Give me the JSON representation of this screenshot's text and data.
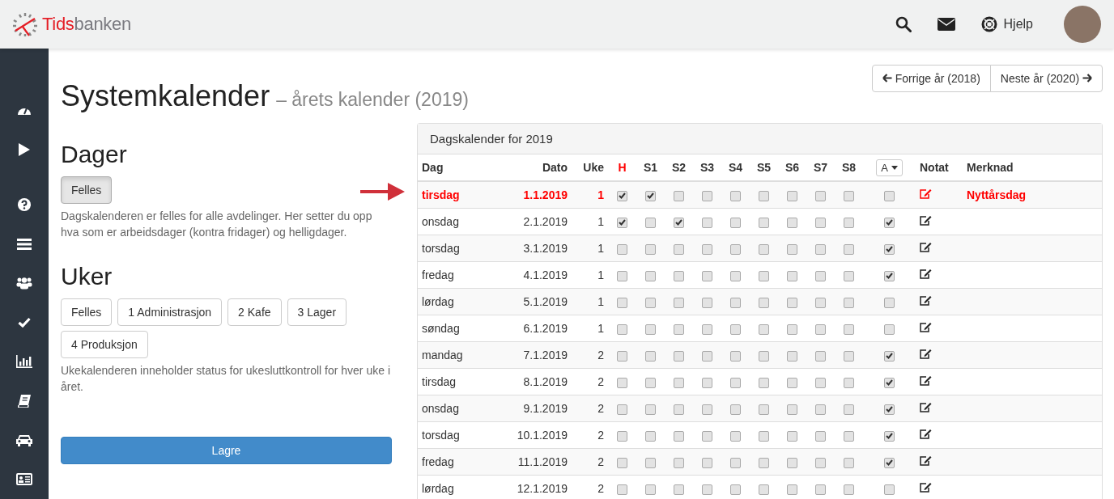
{
  "brand": {
    "part_a": "Tids",
    "part_b": "banken"
  },
  "topbar": {
    "help_label": "Hjelp"
  },
  "page": {
    "title": "Systemkalender",
    "subtitle": "– årets kalender (2019)",
    "prev_year": "Forrige år (2018)",
    "next_year": "Neste år (2020)"
  },
  "days_section": {
    "heading": "Dager",
    "buttons": [
      {
        "label": "Felles",
        "selected": true
      }
    ],
    "description": "Dagskalenderen er felles for alle avdelinger. Her setter du opp hva som er arbeidsdager (kontra fridager) og helligdager."
  },
  "weeks_section": {
    "heading": "Uker",
    "buttons": [
      {
        "label": "Felles",
        "selected": false
      },
      {
        "label": "1 Administrasjon",
        "selected": false
      },
      {
        "label": "2 Kafe",
        "selected": false
      },
      {
        "label": "3 Lager",
        "selected": false
      },
      {
        "label": "4 Produksjon",
        "selected": false
      }
    ],
    "description": "Ukekalenderen inneholder status for ukesluttkontroll for hver uke i året."
  },
  "save_button": "Lagre",
  "calendar": {
    "title": "Dagskalender for 2019",
    "columns": {
      "day": "Dag",
      "date": "Dato",
      "week": "Uke",
      "checks": [
        "H",
        "S1",
        "S2",
        "S3",
        "S4",
        "S5",
        "S6",
        "S7",
        "S8"
      ],
      "dropdown": "A",
      "note": "Notat",
      "remark": "Merknad"
    },
    "rows": [
      {
        "day": "tirsdag",
        "date": "1.1.2019",
        "week": "1",
        "holiday": true,
        "checks": [
          true,
          true,
          false,
          false,
          false,
          false,
          false,
          false,
          false
        ],
        "a": false,
        "remark": "Nyttårsdag"
      },
      {
        "day": "onsdag",
        "date": "2.1.2019",
        "week": "1",
        "holiday": false,
        "checks": [
          true,
          false,
          true,
          false,
          false,
          false,
          false,
          false,
          false
        ],
        "a": true
      },
      {
        "day": "torsdag",
        "date": "3.1.2019",
        "week": "1",
        "holiday": false,
        "checks": [
          false,
          false,
          false,
          false,
          false,
          false,
          false,
          false,
          false
        ],
        "a": true
      },
      {
        "day": "fredag",
        "date": "4.1.2019",
        "week": "1",
        "holiday": false,
        "checks": [
          false,
          false,
          false,
          false,
          false,
          false,
          false,
          false,
          false
        ],
        "a": true
      },
      {
        "day": "lørdag",
        "date": "5.1.2019",
        "week": "1",
        "holiday": false,
        "checks": [
          false,
          false,
          false,
          false,
          false,
          false,
          false,
          false,
          false
        ],
        "a": false
      },
      {
        "day": "søndag",
        "date": "6.1.2019",
        "week": "1",
        "holiday": false,
        "checks": [
          false,
          false,
          false,
          false,
          false,
          false,
          false,
          false,
          false
        ],
        "a": false
      },
      {
        "day": "mandag",
        "date": "7.1.2019",
        "week": "2",
        "holiday": false,
        "checks": [
          false,
          false,
          false,
          false,
          false,
          false,
          false,
          false,
          false
        ],
        "a": true
      },
      {
        "day": "tirsdag",
        "date": "8.1.2019",
        "week": "2",
        "holiday": false,
        "checks": [
          false,
          false,
          false,
          false,
          false,
          false,
          false,
          false,
          false
        ],
        "a": true
      },
      {
        "day": "onsdag",
        "date": "9.1.2019",
        "week": "2",
        "holiday": false,
        "checks": [
          false,
          false,
          false,
          false,
          false,
          false,
          false,
          false,
          false
        ],
        "a": true
      },
      {
        "day": "torsdag",
        "date": "10.1.2019",
        "week": "2",
        "holiday": false,
        "checks": [
          false,
          false,
          false,
          false,
          false,
          false,
          false,
          false,
          false
        ],
        "a": true
      },
      {
        "day": "fredag",
        "date": "11.1.2019",
        "week": "2",
        "holiday": false,
        "checks": [
          false,
          false,
          false,
          false,
          false,
          false,
          false,
          false,
          false
        ],
        "a": true
      },
      {
        "day": "lørdag",
        "date": "12.1.2019",
        "week": "2",
        "holiday": false,
        "checks": [
          false,
          false,
          false,
          false,
          false,
          false,
          false,
          false,
          false
        ],
        "a": false
      }
    ]
  }
}
